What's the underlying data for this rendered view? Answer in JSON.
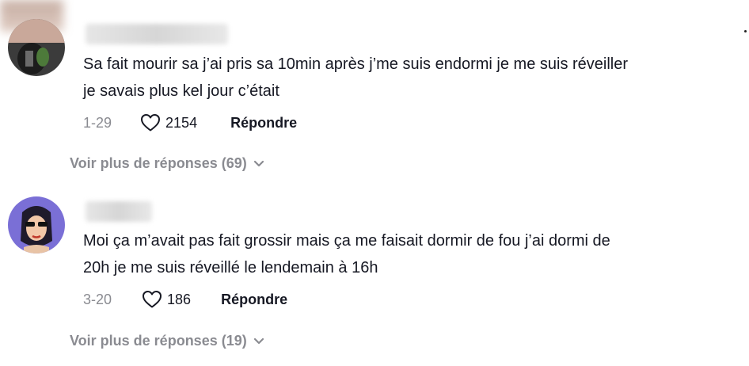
{
  "comments": [
    {
      "text_line1": "Sa fait mourir sa j’ai pris sa 10min après j’me suis endormi je me suis réveiller",
      "text_line2": "je savais plus kel jour c’était",
      "date": "1-29",
      "likes": "2154",
      "reply_label": "Répondre",
      "more_replies": "Voir plus de réponses (69)"
    },
    {
      "text_line1": "Moi ça m’avait pas fait grossir mais ça me faisait dormir de fou j’ai dormi de",
      "text_line2": "20h je me suis réveillé le lendemain à 16h",
      "date": "3-20",
      "likes": "186",
      "reply_label": "Répondre",
      "more_replies": "Voir plus de réponses (19)"
    }
  ],
  "icons": {
    "like": "heart-outline-icon",
    "expand": "chevron-down-icon"
  },
  "colors": {
    "text": "#161823",
    "muted": "#8a8b91"
  }
}
